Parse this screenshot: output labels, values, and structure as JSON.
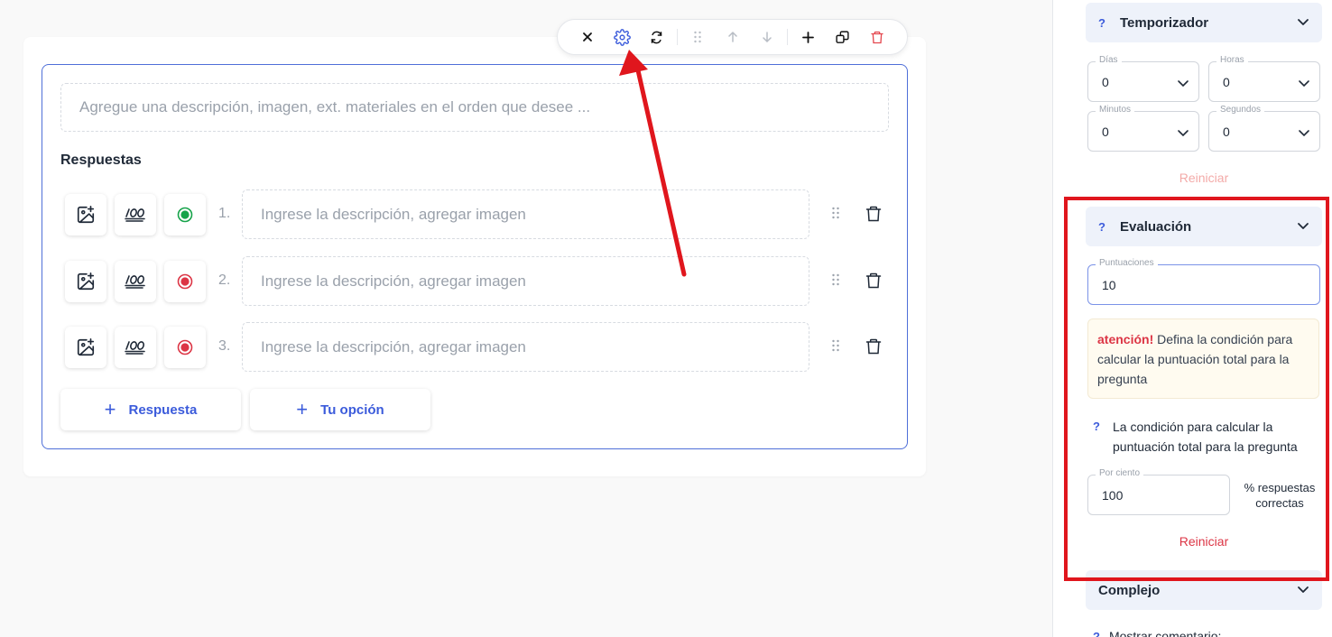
{
  "toolbar": {
    "buttons": [
      {
        "icon": "close-icon",
        "label": "Cerrar"
      },
      {
        "icon": "gear-icon",
        "label": "Configuración"
      },
      {
        "icon": "refresh-icon",
        "label": "Cambiar tipo"
      },
      {
        "icon": "drag-handle-icon",
        "label": "Mover"
      },
      {
        "icon": "arrow-up-icon",
        "label": "Subir"
      },
      {
        "icon": "arrow-down-icon",
        "label": "Bajar"
      },
      {
        "icon": "plus-icon",
        "label": "Agregar"
      },
      {
        "icon": "duplicate-icon",
        "label": "Duplicar"
      },
      {
        "icon": "trash-icon",
        "label": "Eliminar"
      }
    ]
  },
  "question": {
    "description_placeholder": "Agregue una descripción, imagen, ext. materiales en el orden que desee ...",
    "answers_title": "Respuestas",
    "answers": [
      {
        "number": "1.",
        "placeholder": "Ingrese la descripción, agregar imagen",
        "status": "correct"
      },
      {
        "number": "2.",
        "placeholder": "Ingrese la descripción, agregar imagen",
        "status": "incorrect"
      },
      {
        "number": "3.",
        "placeholder": "Ingrese la descripción, agregar imagen",
        "status": "incorrect"
      }
    ],
    "add_answer_label": "Respuesta",
    "add_option_label": "Tu opción"
  },
  "sidebar": {
    "timer": {
      "help": "?",
      "title": "Temporizador",
      "fields": [
        {
          "label": "Días",
          "value": "0"
        },
        {
          "label": "Horas",
          "value": "0"
        },
        {
          "label": "Minutos",
          "value": "0"
        },
        {
          "label": "Segundos",
          "value": "0"
        }
      ],
      "reset_label": "Reiniciar"
    },
    "evaluation": {
      "help": "?",
      "title": "Evaluación",
      "score_label": "Puntuaciones",
      "score_value": "10",
      "warning_strong": "atención!",
      "warning_text": " Defina la condición para calcular la puntuación total para la pregunta",
      "condition_help": "?",
      "condition_text": "La condición para calcular la puntuación total para la pregunta",
      "percent_label": "Por ciento",
      "percent_value": "100",
      "percent_unit": "% respuestas correctas",
      "reset_label": "Reiniciar"
    },
    "complex": {
      "title": "Complejo"
    },
    "next_item": {
      "help": "?",
      "label": "Mostrar comentario:"
    }
  },
  "colors": {
    "accent": "#3b5bdb",
    "correct": "#16a34a",
    "incorrect": "#dc3545",
    "annotation": "#e0161d"
  }
}
